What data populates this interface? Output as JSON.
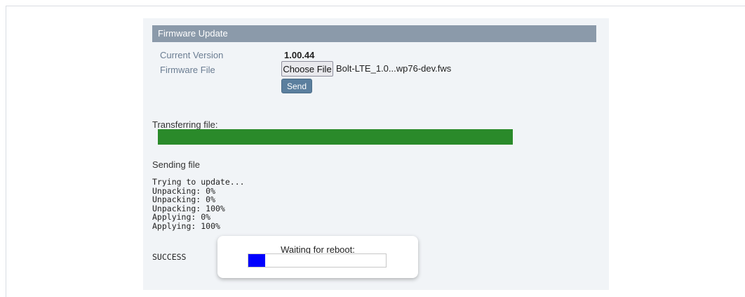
{
  "panel": {
    "title": "Firmware Update",
    "current_version_label": "Current Version",
    "current_version_value": "1.00.44",
    "firmware_file_label": "Firmware File",
    "choose_file_label": "Choose File",
    "selected_file_name": "Bolt-LTE_1.0...wp76-dev.fws",
    "send_label": "Send"
  },
  "transfer": {
    "label": "Transferring file:",
    "progress_fraction": 1.0,
    "bar_color": "#2a8a2a"
  },
  "status": {
    "sending_label": "Sending file",
    "log_lines": [
      "Trying to update...",
      "Unpacking: 0%",
      "Unpacking: 0%",
      "Unpacking: 100%",
      "Applying: 0%",
      "Applying: 100%"
    ],
    "result": "SUCCESS"
  },
  "reboot_dialog": {
    "title": "Waiting for reboot:",
    "progress_fraction": 0.12,
    "bar_color": "#0000ff"
  }
}
